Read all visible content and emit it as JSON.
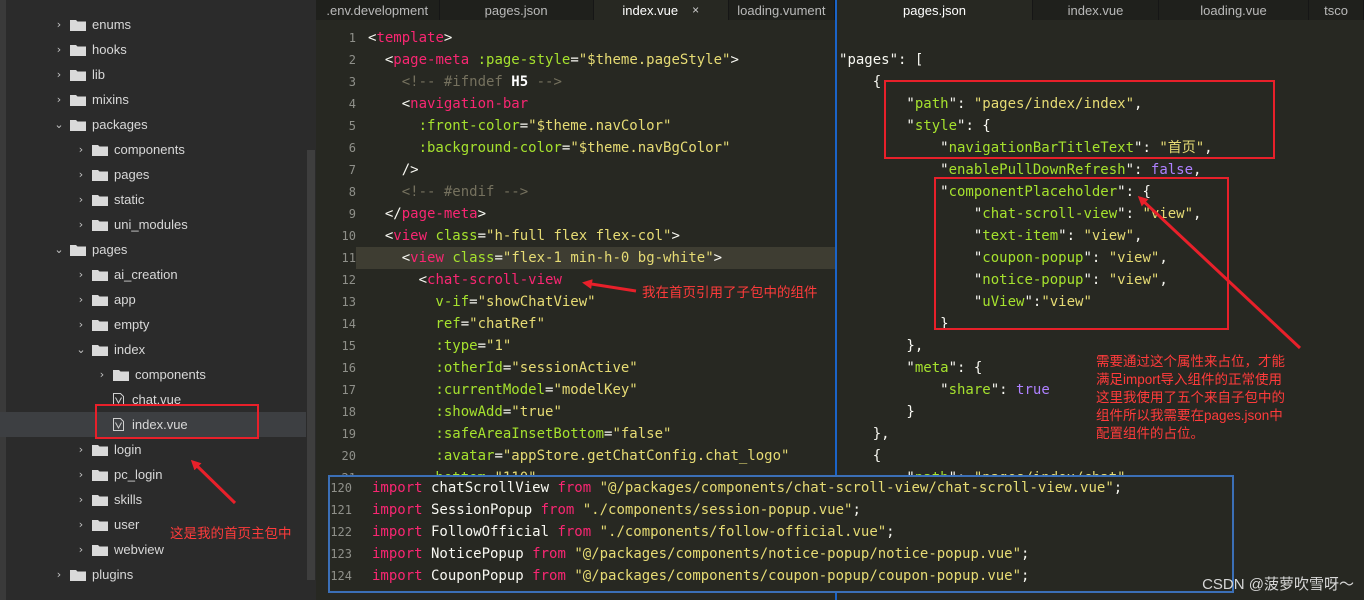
{
  "sidebar": {
    "items": [
      {
        "label": "enums",
        "kind": "folder",
        "state": "collapsed",
        "depth": 1
      },
      {
        "label": "hooks",
        "kind": "folder",
        "state": "collapsed",
        "depth": 1
      },
      {
        "label": "lib",
        "kind": "folder",
        "state": "collapsed",
        "depth": 1
      },
      {
        "label": "mixins",
        "kind": "folder",
        "state": "collapsed",
        "depth": 1
      },
      {
        "label": "packages",
        "kind": "folder",
        "state": "expanded",
        "depth": 1
      },
      {
        "label": "components",
        "kind": "folder",
        "state": "collapsed",
        "depth": 2
      },
      {
        "label": "pages",
        "kind": "folder",
        "state": "collapsed",
        "depth": 2
      },
      {
        "label": "static",
        "kind": "folder",
        "state": "collapsed",
        "depth": 2
      },
      {
        "label": "uni_modules",
        "kind": "folder",
        "state": "collapsed",
        "depth": 2
      },
      {
        "label": "pages",
        "kind": "folder",
        "state": "expanded",
        "depth": 1
      },
      {
        "label": "ai_creation",
        "kind": "folder",
        "state": "collapsed",
        "depth": 2
      },
      {
        "label": "app",
        "kind": "folder",
        "state": "collapsed",
        "depth": 2
      },
      {
        "label": "empty",
        "kind": "folder",
        "state": "collapsed",
        "depth": 2
      },
      {
        "label": "index",
        "kind": "folder",
        "state": "expanded",
        "depth": 2
      },
      {
        "label": "components",
        "kind": "folder",
        "state": "collapsed",
        "depth": 3
      },
      {
        "label": "chat.vue",
        "kind": "file",
        "state": "",
        "depth": 3
      },
      {
        "label": "index.vue",
        "kind": "file",
        "state": "selected",
        "depth": 3
      },
      {
        "label": "login",
        "kind": "folder",
        "state": "collapsed",
        "depth": 2
      },
      {
        "label": "pc_login",
        "kind": "folder",
        "state": "collapsed",
        "depth": 2
      },
      {
        "label": "skills",
        "kind": "folder",
        "state": "collapsed",
        "depth": 2
      },
      {
        "label": "user",
        "kind": "folder",
        "state": "collapsed",
        "depth": 2
      },
      {
        "label": "webview",
        "kind": "folder",
        "state": "collapsed",
        "depth": 2
      },
      {
        "label": "plugins",
        "kind": "folder",
        "state": "collapsed",
        "depth": 1
      }
    ]
  },
  "tabs_left": [
    {
      "label": ".env.development",
      "active": false
    },
    {
      "label": "pages.json",
      "active": false
    },
    {
      "label": "index.vue",
      "active": true,
      "close": "×"
    },
    {
      "label": "loading.vument",
      "active": false
    }
  ],
  "tabs_right": [
    {
      "label": "pages.json",
      "active": true
    },
    {
      "label": "index.vue",
      "active": false
    },
    {
      "label": "loading.vue",
      "active": false
    },
    {
      "label": "tsco",
      "active": false
    }
  ],
  "left_editor": {
    "highlight_line": 11,
    "lines": [
      {
        "n": "1",
        "tokens": [
          [
            "p",
            "<"
          ],
          [
            "t",
            "template"
          ],
          [
            "p",
            ">"
          ]
        ]
      },
      {
        "n": "2",
        "tokens": [
          [
            "p",
            "  <"
          ],
          [
            "t",
            "page-meta"
          ],
          [
            "p",
            " "
          ],
          [
            "a",
            ":page-style"
          ],
          [
            "p",
            "="
          ],
          [
            "s",
            "\"$theme.pageStyle\""
          ],
          [
            "p",
            ">"
          ]
        ]
      },
      {
        "n": "3",
        "tokens": [
          [
            "c",
            "    <!-- #ifndef "
          ],
          [
            "w",
            "H5"
          ],
          [
            "c",
            " -->"
          ]
        ]
      },
      {
        "n": "4",
        "tokens": [
          [
            "p",
            "    <"
          ],
          [
            "t",
            "navigation-bar"
          ]
        ]
      },
      {
        "n": "5",
        "tokens": [
          [
            "a",
            "      :front-color"
          ],
          [
            "p",
            "="
          ],
          [
            "s",
            "\"$theme.navColor\""
          ]
        ]
      },
      {
        "n": "6",
        "tokens": [
          [
            "a",
            "      :background-color"
          ],
          [
            "p",
            "="
          ],
          [
            "s",
            "\"$theme.navBgColor\""
          ]
        ]
      },
      {
        "n": "7",
        "tokens": [
          [
            "p",
            "    />"
          ]
        ]
      },
      {
        "n": "8",
        "tokens": [
          [
            "c",
            "    <!-- #endif -->"
          ]
        ]
      },
      {
        "n": "9",
        "tokens": [
          [
            "p",
            "  </"
          ],
          [
            "t",
            "page-meta"
          ],
          [
            "p",
            ">"
          ]
        ]
      },
      {
        "n": "10",
        "tokens": [
          [
            "p",
            "  <"
          ],
          [
            "t",
            "view"
          ],
          [
            "p",
            " "
          ],
          [
            "a",
            "class"
          ],
          [
            "p",
            "="
          ],
          [
            "s",
            "\"h-full flex flex-col\""
          ],
          [
            "p",
            ">"
          ]
        ]
      },
      {
        "n": "11",
        "tokens": [
          [
            "p",
            "    <"
          ],
          [
            "t",
            "view"
          ],
          [
            "p",
            " "
          ],
          [
            "a",
            "class"
          ],
          [
            "p",
            "="
          ],
          [
            "s",
            "\"flex-1 min-h-0 bg-white\""
          ],
          [
            "p",
            ">"
          ]
        ]
      },
      {
        "n": "12",
        "tokens": [
          [
            "p",
            "      <"
          ],
          [
            "t",
            "chat-scroll-view"
          ]
        ]
      },
      {
        "n": "13",
        "tokens": [
          [
            "a",
            "        v-if"
          ],
          [
            "p",
            "="
          ],
          [
            "s",
            "\"showChatView\""
          ]
        ]
      },
      {
        "n": "14",
        "tokens": [
          [
            "a",
            "        ref"
          ],
          [
            "p",
            "="
          ],
          [
            "s",
            "\"chatRef\""
          ]
        ]
      },
      {
        "n": "15",
        "tokens": [
          [
            "a",
            "        :type"
          ],
          [
            "p",
            "="
          ],
          [
            "s",
            "\"1\""
          ]
        ]
      },
      {
        "n": "16",
        "tokens": [
          [
            "a",
            "        :otherId"
          ],
          [
            "p",
            "="
          ],
          [
            "s",
            "\"sessionActive\""
          ]
        ]
      },
      {
        "n": "17",
        "tokens": [
          [
            "a",
            "        :currentModel"
          ],
          [
            "p",
            "="
          ],
          [
            "s",
            "\"modelKey\""
          ]
        ]
      },
      {
        "n": "18",
        "tokens": [
          [
            "a",
            "        :showAdd"
          ],
          [
            "p",
            "="
          ],
          [
            "s",
            "\"true\""
          ]
        ]
      },
      {
        "n": "19",
        "tokens": [
          [
            "a",
            "        :safeAreaInsetBottom"
          ],
          [
            "p",
            "="
          ],
          [
            "s",
            "\"false\""
          ]
        ]
      },
      {
        "n": "20",
        "tokens": [
          [
            "a",
            "        :avatar"
          ],
          [
            "p",
            "="
          ],
          [
            "s",
            "\"appStore.getChatConfig.chat_logo\""
          ]
        ]
      },
      {
        "n": "21",
        "tokens": [
          [
            "a",
            "        bottom"
          ],
          [
            "p",
            "="
          ],
          [
            "s",
            "\"110\""
          ]
        ]
      }
    ]
  },
  "right_editor": {
    "lines": [
      {
        "tokens": [
          [
            "p",
            "\""
          ],
          [
            "p",
            "pages"
          ],
          [
            "p",
            "\": ["
          ]
        ]
      },
      {
        "tokens": [
          [
            "p",
            "    {"
          ]
        ]
      },
      {
        "tokens": [
          [
            "p",
            "        \""
          ],
          [
            "a",
            "path"
          ],
          [
            "p",
            "\": "
          ],
          [
            "s",
            "\"pages/index/index\""
          ],
          [
            "p",
            ","
          ]
        ]
      },
      {
        "tokens": [
          [
            "p",
            "        \""
          ],
          [
            "a",
            "style"
          ],
          [
            "p",
            "\": {"
          ]
        ]
      },
      {
        "tokens": [
          [
            "p",
            "            \""
          ],
          [
            "a",
            "navigationBarTitleText"
          ],
          [
            "p",
            "\": "
          ],
          [
            "s",
            "\"首页\""
          ],
          [
            "p",
            ","
          ]
        ]
      },
      {
        "tokens": [
          [
            "p",
            "            \""
          ],
          [
            "a",
            "enablePullDownRefresh"
          ],
          [
            "p",
            "\": "
          ],
          [
            "k",
            "false"
          ],
          [
            "p",
            ","
          ]
        ]
      },
      {
        "tokens": [
          [
            "p",
            "            \""
          ],
          [
            "a",
            "componentPlaceholder"
          ],
          [
            "p",
            "\": {"
          ]
        ]
      },
      {
        "tokens": [
          [
            "p",
            "                \""
          ],
          [
            "a",
            "chat-scroll-view"
          ],
          [
            "p",
            "\": "
          ],
          [
            "s",
            "\"view\""
          ],
          [
            "p",
            ","
          ]
        ]
      },
      {
        "tokens": [
          [
            "p",
            "                \""
          ],
          [
            "a",
            "text-item"
          ],
          [
            "p",
            "\": "
          ],
          [
            "s",
            "\"view\""
          ],
          [
            "p",
            ","
          ]
        ]
      },
      {
        "tokens": [
          [
            "p",
            "                \""
          ],
          [
            "a",
            "coupon-popup"
          ],
          [
            "p",
            "\": "
          ],
          [
            "s",
            "\"view\""
          ],
          [
            "p",
            ","
          ]
        ]
      },
      {
        "tokens": [
          [
            "p",
            "                \""
          ],
          [
            "a",
            "notice-popup"
          ],
          [
            "p",
            "\": "
          ],
          [
            "s",
            "\"view\""
          ],
          [
            "p",
            ","
          ]
        ]
      },
      {
        "tokens": [
          [
            "p",
            "                \""
          ],
          [
            "a",
            "uView"
          ],
          [
            "p",
            "\":"
          ],
          [
            "s",
            "\"view\""
          ]
        ]
      },
      {
        "tokens": [
          [
            "p",
            "            }"
          ]
        ]
      },
      {
        "tokens": [
          [
            "p",
            "        },"
          ]
        ]
      },
      {
        "tokens": [
          [
            "p",
            "        \""
          ],
          [
            "a",
            "meta"
          ],
          [
            "p",
            "\": {"
          ]
        ]
      },
      {
        "tokens": [
          [
            "p",
            "            \""
          ],
          [
            "a",
            "share"
          ],
          [
            "p",
            "\": "
          ],
          [
            "k",
            "true"
          ]
        ]
      },
      {
        "tokens": [
          [
            "p",
            "        }"
          ]
        ]
      },
      {
        "tokens": [
          [
            "p",
            "    },"
          ]
        ]
      },
      {
        "tokens": [
          [
            "p",
            "    {"
          ]
        ]
      },
      {
        "tokens": [
          [
            "p",
            "        \""
          ],
          [
            "a",
            "path"
          ],
          [
            "p",
            "\": "
          ],
          [
            "s",
            "\"pages/index/chat\""
          ]
        ]
      }
    ]
  },
  "import_panel": {
    "lines": [
      {
        "n": "120",
        "tokens": [
          [
            "t",
            "import"
          ],
          [
            "p",
            " chatScrollView "
          ],
          [
            "t",
            "from"
          ],
          [
            "p",
            " "
          ],
          [
            "s",
            "\"@/packages/components/chat-scroll-view/chat-scroll-view.vue\""
          ],
          [
            "p",
            ";"
          ]
        ]
      },
      {
        "n": "121",
        "tokens": [
          [
            "t",
            "import"
          ],
          [
            "p",
            " SessionPopup "
          ],
          [
            "t",
            "from"
          ],
          [
            "p",
            " "
          ],
          [
            "s",
            "\"./components/session-popup.vue\""
          ],
          [
            "p",
            ";"
          ]
        ]
      },
      {
        "n": "122",
        "tokens": [
          [
            "t",
            "import"
          ],
          [
            "p",
            " FollowOfficial "
          ],
          [
            "t",
            "from"
          ],
          [
            "p",
            " "
          ],
          [
            "s",
            "\"./components/follow-official.vue\""
          ],
          [
            "p",
            ";"
          ]
        ]
      },
      {
        "n": "123",
        "tokens": [
          [
            "t",
            "import"
          ],
          [
            "p",
            " NoticePopup "
          ],
          [
            "t",
            "from"
          ],
          [
            "p",
            " "
          ],
          [
            "s",
            "\"@/packages/components/notice-popup/notice-popup.vue\""
          ],
          [
            "p",
            ";"
          ]
        ]
      },
      {
        "n": "124",
        "tokens": [
          [
            "t",
            "import"
          ],
          [
            "p",
            " CouponPopup "
          ],
          [
            "t",
            "from"
          ],
          [
            "p",
            " "
          ],
          [
            "s",
            "\"@/packages/components/coupon-popup/coupon-popup.vue\""
          ],
          [
            "p",
            ";"
          ]
        ]
      }
    ]
  },
  "annotations": {
    "left_note": "我在首页引用了子包中的组件",
    "sidebar_note": "这是我的首页主包中",
    "right_note_lines": [
      "需要通过这个属性来占位，才能",
      "满足import导入组件的正常使用",
      "这里我使用了五个来自子包中的",
      "组件所以我需要在pages.json中",
      "配置组件的占位。"
    ]
  },
  "watermark": "CSDN @菠萝吹雪呀～",
  "colors": {
    "annotation_red": "#e8202a",
    "tag": "#f92672",
    "attribute": "#a6e22e",
    "string": "#e6db74",
    "comment": "#75715e",
    "split_blue": "#1b64c8"
  }
}
